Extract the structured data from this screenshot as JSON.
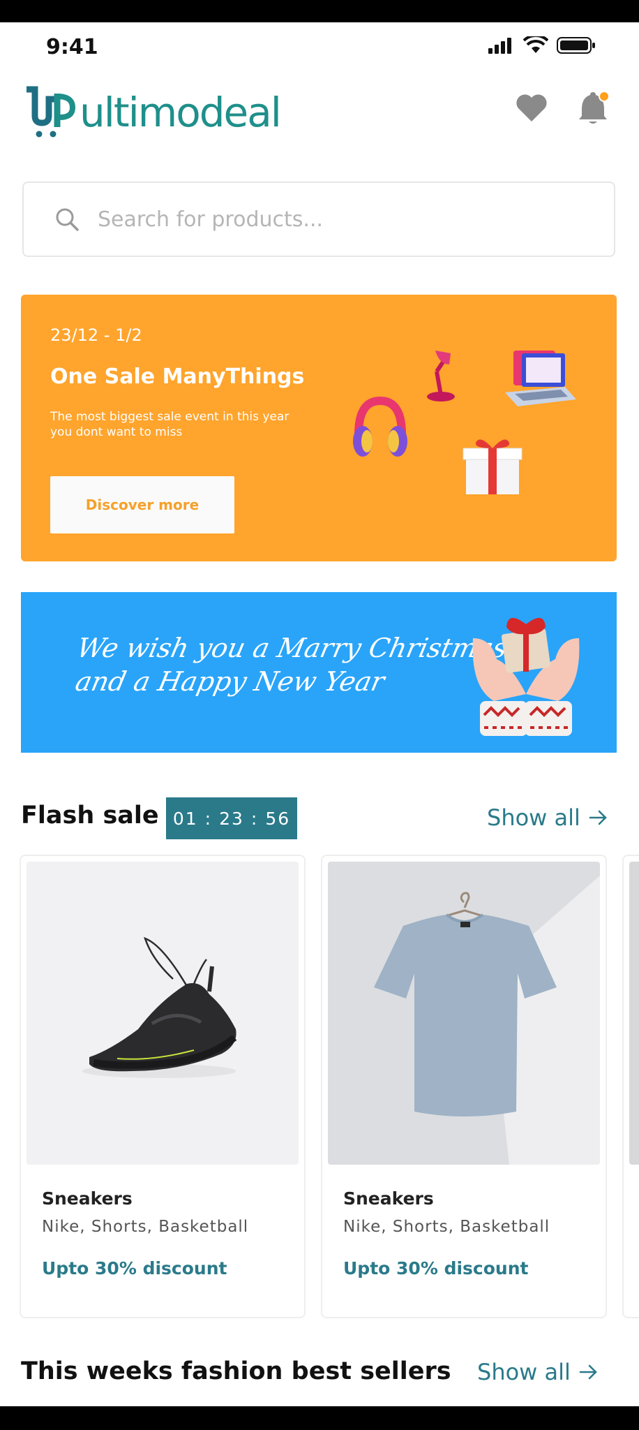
{
  "status_bar": {
    "time": "9:41"
  },
  "header": {
    "brand": "ultimodeal"
  },
  "search": {
    "placeholder": "Search for products..."
  },
  "promo": {
    "date_range": "23/12 - 1/2",
    "title": "One Sale ManyThings",
    "subtitle": "The most biggest sale event in this year you dont want to miss",
    "button_label": "Discover more",
    "color": "#FFA42C"
  },
  "xmas_banner": {
    "line1": "We wish you a Marry Christmas",
    "line2": "and a Happy New Year",
    "color": "#29A4F9"
  },
  "flash_sale": {
    "title": "Flash sale",
    "timer": {
      "hours": "01",
      "minutes": "23",
      "seconds": "56"
    },
    "show_all": "Show all"
  },
  "products": [
    {
      "name": "Sneakers",
      "tags": "Nike, Shorts, Basketball",
      "discount": "Upto 30% discount",
      "image_icon": "sneaker-image"
    },
    {
      "name": "Sneakers",
      "tags": "Nike, Shorts, Basketball",
      "discount": "Upto 30% discount",
      "image_icon": "tshirt-image"
    }
  ],
  "best_sellers": {
    "title": "This weeks fashion best sellers",
    "show_all": "Show all"
  },
  "accent_color": "#2A7A8A"
}
